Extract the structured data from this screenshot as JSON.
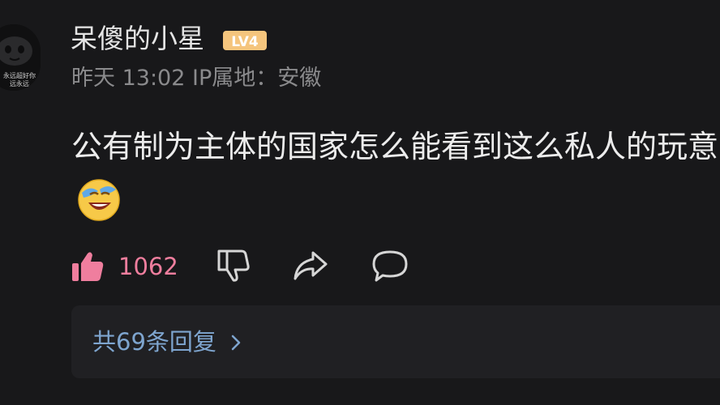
{
  "comment": {
    "username": "呆傻的小星",
    "level_badge": "LV4",
    "timestamp": "昨天 13:02",
    "ip_location": "IP属地：安徽",
    "avatar_caption_1": "永远超好你",
    "avatar_caption_2": "远永远",
    "text": "公有制为主体的国家怎么能看到这么私人的玩意",
    "emoji": "crying-laugh-emoji",
    "like_count": "1062",
    "replies_label": "共69条回复"
  },
  "icons": {
    "like": "thumbs-up-filled-icon",
    "dislike": "thumbs-down-outline-icon",
    "share": "share-arrow-icon",
    "reply": "speech-bubble-icon",
    "chevron": "chevron-right-icon"
  },
  "colors": {
    "background": "#18181a",
    "like_pink": "#ef7e9e",
    "link_blue": "#7ea5cf",
    "level_badge": "#f5c57d",
    "meta_gray": "#8a8a8c"
  }
}
